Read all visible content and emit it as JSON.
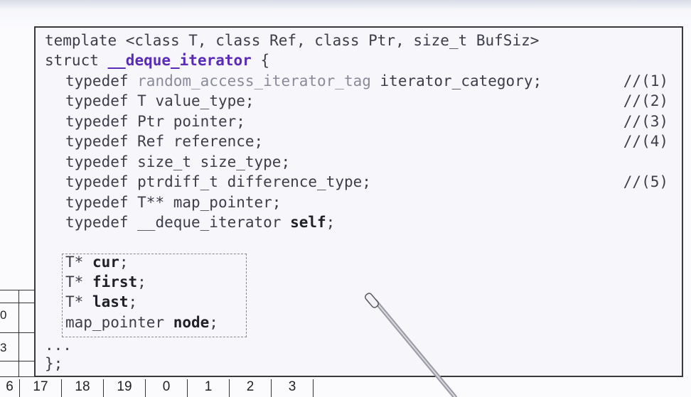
{
  "code": {
    "header_line": "template <class T, class Ref, class Ptr, size_t BufSiz>",
    "struct_kw": "struct ",
    "struct_name": "__deque_iterator",
    "struct_open": " {",
    "typedefs": [
      {
        "kw": "typedef ",
        "type": "random_access_iterator_tag",
        "rest": " iterator_category;",
        "comment": "//(1)",
        "type_gray": true
      },
      {
        "kw": "typedef ",
        "type": "T",
        "rest": " value_type;",
        "comment": "//(2)",
        "type_gray": false
      },
      {
        "kw": "typedef ",
        "type": "Ptr",
        "rest": " pointer;",
        "comment": "//(3)",
        "type_gray": false
      },
      {
        "kw": "typedef ",
        "type": "Ref",
        "rest": " reference;",
        "comment": "//(4)",
        "type_gray": false
      },
      {
        "kw": "typedef ",
        "type": "size_t",
        "rest": " size_type;",
        "comment": "",
        "type_gray": false
      },
      {
        "kw": "typedef ",
        "type": "ptrdiff_t",
        "rest": " difference_type;",
        "comment": "//(5)",
        "type_gray": false
      },
      {
        "kw": "typedef ",
        "type": "T**",
        "rest": " map_pointer;",
        "comment": "",
        "type_gray": false
      }
    ],
    "self_line": {
      "kw": "typedef ",
      "type": "__deque_iterator ",
      "name": "self",
      "end": ";"
    },
    "fields": [
      {
        "type": "T* ",
        "name": "cur",
        "end": ";"
      },
      {
        "type": "T* ",
        "name": "first",
        "end": ";"
      },
      {
        "type": "T* ",
        "name": "last",
        "end": ";"
      },
      {
        "type": "map_pointer ",
        "name": "node",
        "end": ";"
      }
    ],
    "ellipsis": "...",
    "close": "};"
  },
  "bottom_numbers": [
    "6",
    "17",
    "18",
    "19",
    "0",
    "1",
    "2",
    "3"
  ],
  "left_labels": [
    "0",
    "3"
  ],
  "colors": {
    "accent": "#5a2ab8",
    "frame": "#3a3a3a"
  }
}
